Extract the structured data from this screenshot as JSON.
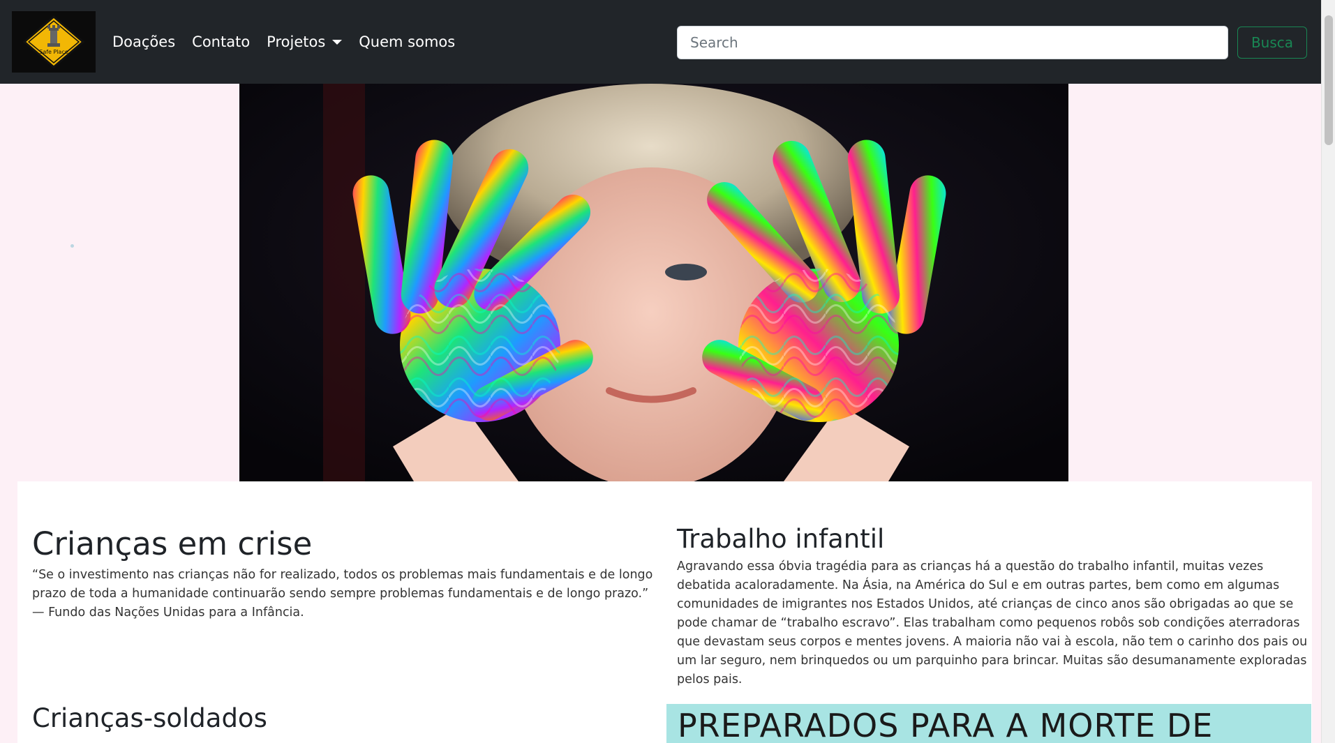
{
  "brand": {
    "logo_text": "Safe Place"
  },
  "nav": {
    "items": [
      {
        "label": "Doações"
      },
      {
        "label": "Contato"
      },
      {
        "label": "Projetos"
      },
      {
        "label": "Quem somos"
      }
    ]
  },
  "search": {
    "placeholder": "Search",
    "button_label": "Busca"
  },
  "sections": {
    "criancas_em_crise": {
      "title": "Crianças em crise",
      "text": "“Se o investimento nas crianças não for realizado, todos os problemas mais fundamentais e de longo prazo de toda a humanidade continuarão sendo sempre problemas fundamentais e de longo prazo.” — Fundo das Nações Unidas para a Infância."
    },
    "trabalho_infantil": {
      "title": "Trabalho infantil",
      "text": "Agravando essa óbvia tragédia para as crianças há a questão do trabalho infantil, muitas vezes debatida acaloradamente. Na Ásia, na América do Sul e em outras partes, bem como em algumas comunidades de imigrantes nos Estados Unidos, até crianças de cinco anos são obrigadas ao que se pode chamar de “trabalho escravo”. Elas trabalham como pequenos robôs sob condições aterradoras que devastam seus corpos e mentes jovens. A maioria não vai à escola, não tem o carinho dos pais ou um lar seguro, nem brinquedos ou um parquinho para brincar. Muitas são desumanamente exploradas pelos pais."
    },
    "criancas_soldados": {
      "title": "Crianças-soldados"
    },
    "preparados": {
      "title": "PREPARADOS PARA A MORTE DE"
    }
  },
  "colors": {
    "navbar_bg": "#212529",
    "page_bg": "#fdf0f6",
    "accent_green": "#198754",
    "teal_box": "#a8e4e3"
  },
  "icons": {
    "dropdown": "caret-down-icon",
    "logo": "chess-rook-road-sign-logo"
  }
}
